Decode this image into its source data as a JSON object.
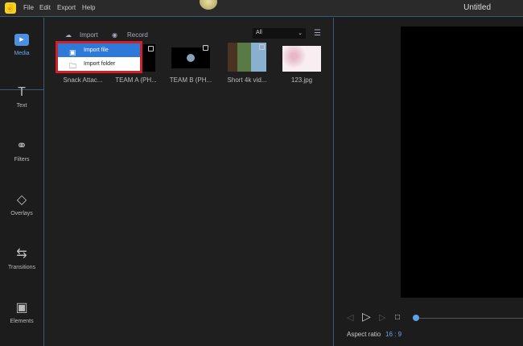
{
  "menu": {
    "items": [
      "File",
      "Edit",
      "Export",
      "Help"
    ]
  },
  "window": {
    "title": "Untitled"
  },
  "sidebar": {
    "items": [
      {
        "label": "Media",
        "icon": "media-icon"
      },
      {
        "label": "Text",
        "icon": "text-icon"
      },
      {
        "label": "Filters",
        "icon": "filters-icon"
      },
      {
        "label": "Overlays",
        "icon": "overlays-icon"
      },
      {
        "label": "Transitions",
        "icon": "transitions-icon"
      },
      {
        "label": "Elements",
        "icon": "elements-icon"
      }
    ]
  },
  "toolbar": {
    "import": "Import",
    "record": "Record",
    "filter": "All"
  },
  "dropdown": {
    "items": [
      "Import file",
      "Import folder"
    ]
  },
  "media": [
    {
      "label": "Snack Attac..."
    },
    {
      "label": "TEAM A (PH..."
    },
    {
      "label": "TEAM B (PH..."
    },
    {
      "label": "Short 4k vid..."
    },
    {
      "label": "123.jpg"
    }
  ],
  "player": {
    "aspect_label": "Aspect ratio",
    "aspect_value": "16 : 9",
    "progress": 0
  },
  "colors": {
    "accent": "#4d8fe0",
    "highlight": "#d0202a"
  }
}
